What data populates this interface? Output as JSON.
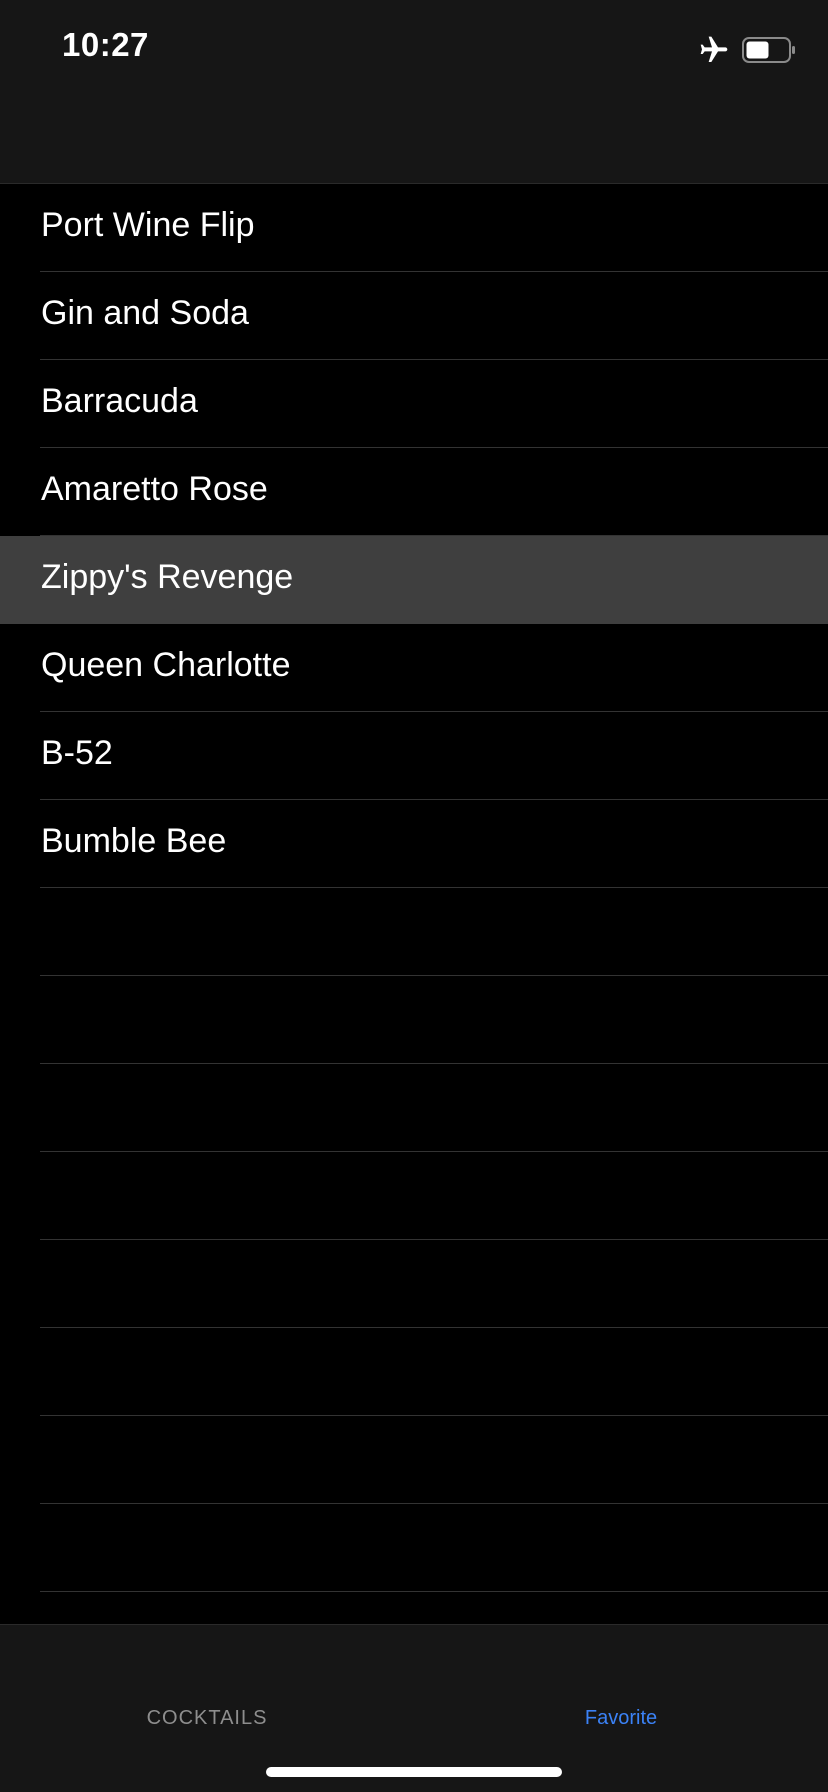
{
  "status_bar": {
    "time": "10:27",
    "icons": [
      "airplane-icon",
      "battery-icon"
    ]
  },
  "list": {
    "items": [
      {
        "label": "Port Wine Flip",
        "selected": false
      },
      {
        "label": "Gin and Soda",
        "selected": false
      },
      {
        "label": "Barracuda",
        "selected": false
      },
      {
        "label": "Amaretto Rose",
        "selected": false
      },
      {
        "label": "Zippy's Revenge",
        "selected": true
      },
      {
        "label": "Queen Charlotte",
        "selected": false
      },
      {
        "label": "B-52",
        "selected": false
      },
      {
        "label": "Bumble Bee",
        "selected": false
      },
      {
        "label": "",
        "selected": false
      },
      {
        "label": "",
        "selected": false
      },
      {
        "label": "",
        "selected": false
      },
      {
        "label": "",
        "selected": false
      },
      {
        "label": "",
        "selected": false
      },
      {
        "label": "",
        "selected": false
      },
      {
        "label": "",
        "selected": false
      },
      {
        "label": "",
        "selected": false
      }
    ]
  },
  "tab_bar": {
    "tabs": [
      {
        "label": "COCKTAILS",
        "active": false
      },
      {
        "label": "Favorite",
        "active": true
      }
    ]
  },
  "colors": {
    "accent": "#3b82f6",
    "background": "#000000",
    "bar_background": "#161616",
    "selected_row": "#3f3f3f"
  }
}
